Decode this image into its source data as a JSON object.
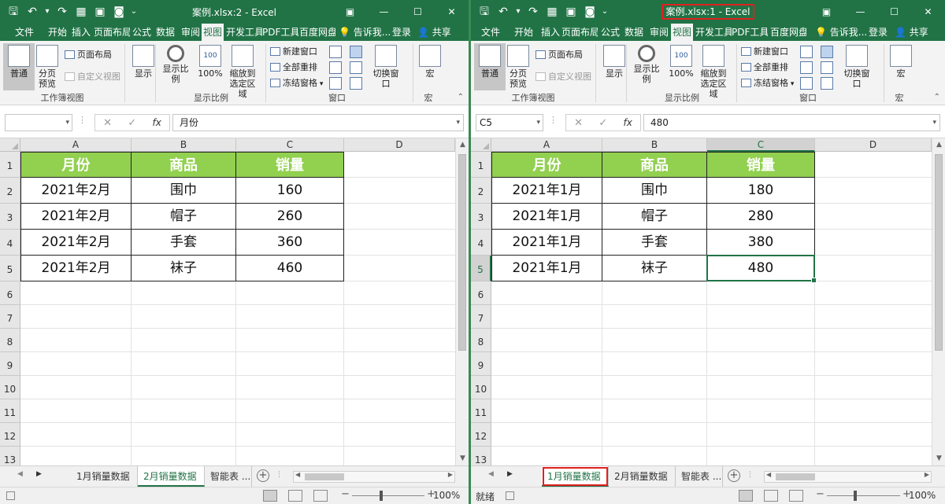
{
  "windows": [
    {
      "title": "案例.xlsx:2 - Excel",
      "title_highlighted": false,
      "tabs": [
        "文件",
        "开始",
        "插入",
        "页面布局",
        "公式",
        "数据",
        "审阅",
        "视图",
        "开发工具",
        "PDF工具",
        "百度网盘"
      ],
      "active_tab": "视图",
      "tell_me": "告诉我...",
      "login": "登录",
      "share": "共享",
      "ribbon": {
        "workbook_views": {
          "normal": "普通",
          "page_break": "分页\n预览",
          "page_layout": "页面布局",
          "custom_views": "自定义视图",
          "group_label": "工作簿视图"
        },
        "show": {
          "label": "显示"
        },
        "zoom": {
          "zoom_label": "显示比例",
          "zoom100": "100%",
          "zoom_selection": "缩放到\n选定区域",
          "group_label": "显示比例"
        },
        "window": {
          "new_window": "新建窗口",
          "arrange_all": "全部重排",
          "freeze": "冻结窗格",
          "switch": "切换窗口",
          "group_label": "窗口"
        },
        "macros": {
          "label": "宏",
          "group_label": "宏"
        }
      },
      "name_box": "",
      "formula": "月份",
      "columns": [
        "A",
        "B",
        "C",
        "D"
      ],
      "rows": [
        "1",
        "2",
        "3",
        "4",
        "5",
        "6",
        "7",
        "8",
        "9",
        "10",
        "11",
        "12",
        "13"
      ],
      "table": {
        "headers": [
          "月份",
          "商品",
          "销量"
        ],
        "rows": [
          [
            "2021年2月",
            "围巾",
            "160"
          ],
          [
            "2021年2月",
            "帽子",
            "260"
          ],
          [
            "2021年2月",
            "手套",
            "360"
          ],
          [
            "2021年2月",
            "袜子",
            "460"
          ]
        ]
      },
      "selected_cell": null,
      "sheets": [
        "1月销量数据",
        "2月销量数据",
        "智能表 ..."
      ],
      "active_sheet": 1,
      "highlighted_sheet": null,
      "status": {
        "ready": "",
        "zoom": "100%"
      }
    },
    {
      "title": "案例.xlsx:1 - Excel",
      "title_highlighted": true,
      "tabs": [
        "文件",
        "开始",
        "插入",
        "页面布局",
        "公式",
        "数据",
        "审阅",
        "视图",
        "开发工具",
        "PDF工具",
        "百度网盘"
      ],
      "active_tab": "视图",
      "tell_me": "告诉我...",
      "login": "登录",
      "share": "共享",
      "ribbon": {
        "workbook_views": {
          "normal": "普通",
          "page_break": "分页\n预览",
          "page_layout": "页面布局",
          "custom_views": "自定义视图",
          "group_label": "工作簿视图"
        },
        "show": {
          "label": "显示"
        },
        "zoom": {
          "zoom_label": "显示比例",
          "zoom100": "100%",
          "zoom_selection": "缩放到\n选定区域",
          "group_label": "显示比例"
        },
        "window": {
          "new_window": "新建窗口",
          "arrange_all": "全部重排",
          "freeze": "冻结窗格",
          "switch": "切换窗口",
          "group_label": "窗口"
        },
        "macros": {
          "label": "宏",
          "group_label": "宏"
        }
      },
      "name_box": "C5",
      "formula": "480",
      "columns": [
        "A",
        "B",
        "C",
        "D"
      ],
      "rows": [
        "1",
        "2",
        "3",
        "4",
        "5",
        "6",
        "7",
        "8",
        "9",
        "10",
        "11",
        "12",
        "13"
      ],
      "table": {
        "headers": [
          "月份",
          "商品",
          "销量"
        ],
        "rows": [
          [
            "2021年1月",
            "围巾",
            "180"
          ],
          [
            "2021年1月",
            "帽子",
            "280"
          ],
          [
            "2021年1月",
            "手套",
            "380"
          ],
          [
            "2021年1月",
            "袜子",
            "480"
          ]
        ]
      },
      "selected_cell": {
        "col": 2,
        "row": 4
      },
      "sheets": [
        "1月销量数据",
        "2月销量数据",
        "智能表 ..."
      ],
      "active_sheet": 0,
      "highlighted_sheet": 0,
      "status": {
        "ready": "就绪",
        "zoom": "100%"
      }
    }
  ],
  "colors": {
    "excel_green": "#217346",
    "header_fill": "#92d050",
    "highlight_red": "#e02020"
  }
}
